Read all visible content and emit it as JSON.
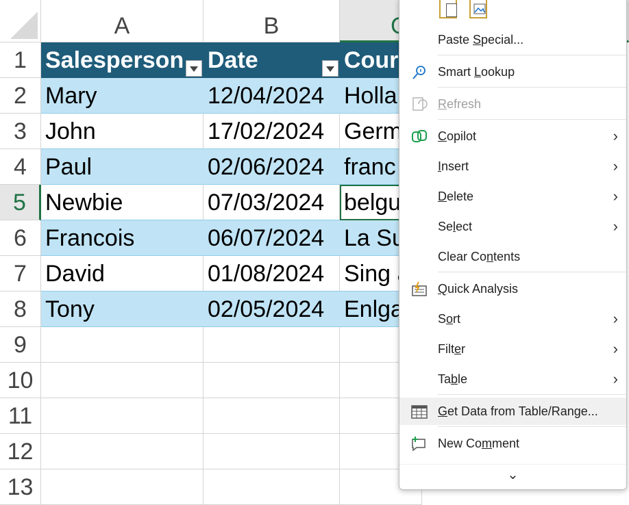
{
  "columns": [
    "A",
    "B",
    "C"
  ],
  "rows": [
    "1",
    "2",
    "3",
    "4",
    "5",
    "6",
    "7",
    "8",
    "9",
    "10",
    "11",
    "12",
    "13"
  ],
  "table": {
    "headers": [
      "Salesperson",
      "Date",
      "Cour"
    ],
    "data": [
      [
        "Mary",
        "12/04/2024",
        "Holla"
      ],
      [
        "John",
        "17/02/2024",
        "Germ"
      ],
      [
        "Paul",
        "02/06/2024",
        "franc"
      ],
      [
        "Newbie",
        "07/03/2024",
        "belgu"
      ],
      [
        "Francois",
        "06/07/2024",
        "La Su"
      ],
      [
        "David",
        "01/08/2024",
        "Sing a"
      ],
      [
        "Tony",
        "02/05/2024",
        "Enlga"
      ]
    ]
  },
  "menu": {
    "paste_special": {
      "before": "Paste ",
      "u": "S",
      "after": "pecial..."
    },
    "smart_lookup": {
      "before": "Smart ",
      "u": "L",
      "after": "ookup"
    },
    "refresh": {
      "before": "",
      "u": "R",
      "after": "efresh"
    },
    "copilot": {
      "before": "",
      "u": "C",
      "after": "opilot"
    },
    "insert": {
      "before": "",
      "u": "I",
      "after": "nsert"
    },
    "delete": {
      "before": "",
      "u": "D",
      "after": "elete"
    },
    "select": {
      "before": "Se",
      "u": "l",
      "after": "ect"
    },
    "clear_contents": {
      "before": "Clear Co",
      "u": "n",
      "after": "tents"
    },
    "quick_analysis": {
      "before": "",
      "u": "Q",
      "after": "uick Analysis"
    },
    "sort": {
      "before": "S",
      "u": "o",
      "after": "rt"
    },
    "filter": {
      "before": "Filt",
      "u": "e",
      "after": "r"
    },
    "table": {
      "before": "Ta",
      "u": "b",
      "after": "le"
    },
    "get_data": {
      "before": "",
      "u": "G",
      "after": "et Data from Table/Range..."
    },
    "new_comment": {
      "before": "New Co",
      "u": "m",
      "after": "ment"
    },
    "more": "⌄"
  },
  "colors": {
    "table_header": "#1f5c7a",
    "band": "#c0e4f5",
    "selection": "#217346"
  }
}
